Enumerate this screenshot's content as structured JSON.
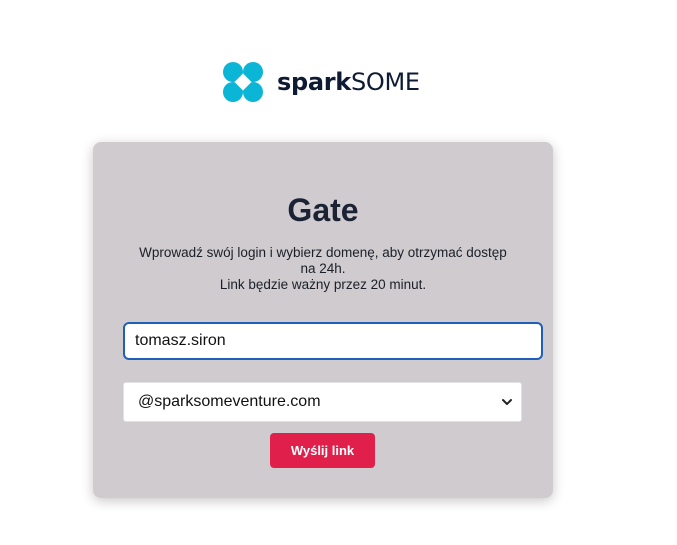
{
  "brand": {
    "name_bold": "spark",
    "name_regular": "SOME",
    "logo_icon": "sparksome-logo-icon",
    "logo_color": "#0bb5d6"
  },
  "card": {
    "title": "Gate",
    "description_lines": [
      "Wprowadź swój login i wybierz domenę, aby otrzymać dostęp",
      "na 24h.",
      "Link będzie ważny przez 20 minut."
    ]
  },
  "form": {
    "login_value": "tomasz.siron",
    "domain_selected": "@sparksomeventure.com",
    "domain_icon": "chevron-down-icon",
    "submit_label": "Wyślij link",
    "submit_color": "#e0204b",
    "focus_color": "#1f5fb8"
  }
}
